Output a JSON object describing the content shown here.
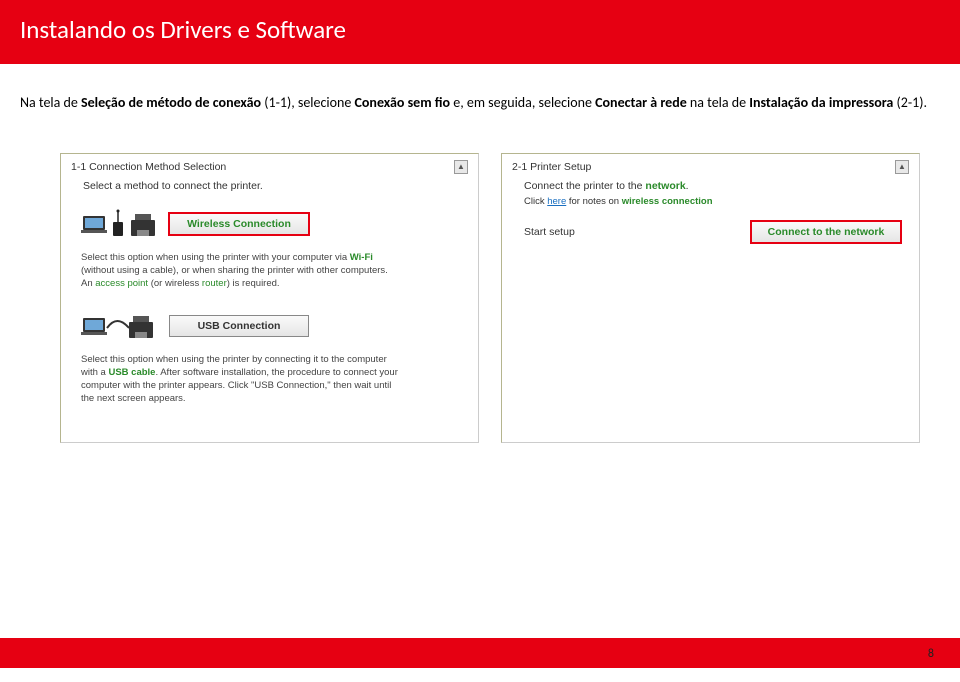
{
  "header": {
    "title": "Instalando os Drivers e Software"
  },
  "intro": {
    "pre": "Na tela de ",
    "bold1": "Seleção de método de conexão",
    "mid1": " (1-1), selecione ",
    "bold2": "Conexão sem fio",
    "mid2": " e, em seguida, selecione ",
    "bold3": "Conectar à rede",
    "mid3": " na tela de ",
    "bold4": "Instalação da impressora",
    "post": " (2-1)."
  },
  "panel1": {
    "title": "1-1 Connection Method Selection",
    "instr": "Select a method to connect the printer.",
    "wireless_btn": "Wireless Connection",
    "wireless_desc_pre": "Select this option when using the printer with your computer via ",
    "wireless_kw1": "Wi-Fi",
    "wireless_desc_mid": " (without using a cable), or when sharing the printer with other computers. An ",
    "wireless_kw2": "access point",
    "wireless_desc_mid2": " (or wireless ",
    "wireless_kw3": "router",
    "wireless_desc_post": ") is required.",
    "usb_btn": "USB Connection",
    "usb_desc_pre": "Select this option when using the printer by connecting it to the computer with a ",
    "usb_kw1": "USB cable",
    "usb_desc_post": ". After software installation, the procedure to connect your computer with the printer appears. Click \"USB Connection,\" then wait until the next screen appears."
  },
  "panel2": {
    "title": "2-1 Printer Setup",
    "instr1": "Connect the printer to the ",
    "instr1_kw": "network",
    "instr1_post": ".",
    "instr2_pre": "Click ",
    "instr2_link": "here",
    "instr2_mid": " for notes on ",
    "instr2_kw": "wireless connection",
    "setup_label": "Start setup",
    "connect_btn": "Connect to the network"
  },
  "page_number": "8"
}
